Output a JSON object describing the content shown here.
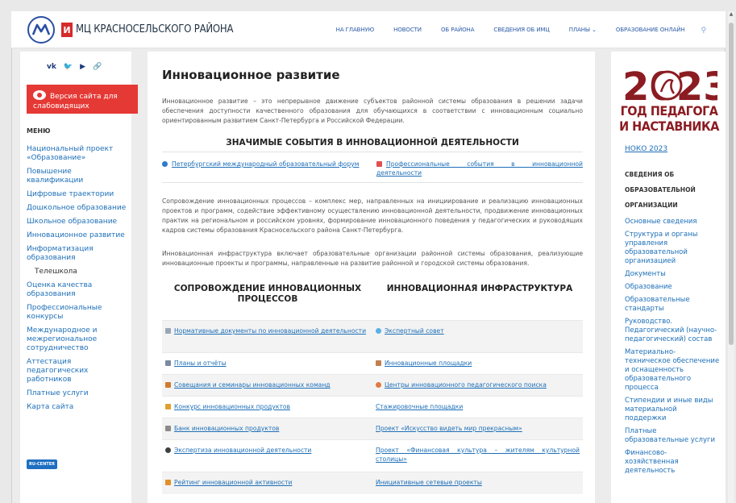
{
  "header": {
    "brand_mark": "И",
    "brand_text": "МЦ КРАСНОСЕЛЬСКОГО РАЙОНА",
    "nav": [
      "НА ГЛАВНУЮ",
      "НОВОСТИ",
      "ОБ РАЙОНА",
      "СВЕДЕНИЯ ОБ ИМЦ",
      "ПЛАНЫ ⌄",
      "ОБРАЗОВАНИЕ ОНЛАЙН"
    ],
    "search_icon": "search-icon"
  },
  "left": {
    "social": [
      "vk",
      "tw",
      "yt",
      "link"
    ],
    "low_vision_label": "Версия сайта для слабовидящих",
    "menu_title": "МЕНЮ",
    "menu": [
      "Национальный проект «Образование»",
      "Повышение квалификации",
      "Цифровые траектории",
      "Дошкольное образование",
      "Школьное образование",
      "Инновационное развитие",
      "Информатизация образования",
      "Телешкола",
      "Оценка качества образования",
      "Профессиональные конкурсы",
      "Международное и межрегиональное сотрудничество",
      "Аттестация педагогических работников",
      "Платные услуги",
      "Карта сайта"
    ],
    "rucenter": "RU-CENTER"
  },
  "main": {
    "title": "Инновационное развитие",
    "intro": "Инновационное развитие – это непрерывное движение субъектов районной системы образования в решении задачи обеспечения доступности качественного образования для обучающихся в соответствии с инновационным социально ориентированным развитием Санкт-Петербурга и Российской Федерации.",
    "events_title": "ЗНАЧИМЫЕ СОБЫТИЯ В ИННОВАЦИОННОЙ ДЕЯТЕЛЬНОСТИ",
    "event_left": "Петербургский международный образовательный форум",
    "event_right": "Профессиональные события в инновационной деятельности",
    "para2": "Сопровождение инновационных процессов – комплекс мер, направленных на инициирование и реализацию инновационных проектов и программ, содействие эффективному осуществлению инновационной деятельности, продвижение инновационных практик на региональном и российском уровнях, формирование инновационного поведения у педагогических и руководящих кадров системы образования Красносельского района Санкт-Петербурга.",
    "para3": "Инновационная инфраструктура включает образовательные организации районной системы образования, реализующие инновационные проекты и программы, направленные на развитие районной и городской системы образования.",
    "col_left_title": "СОПРОВОЖДЕНИЕ ИННОВАЦИОННЫХ ПРОЦЕССОВ",
    "col_right_title": "ИННОВАЦИОННАЯ ИНФРАСТРУКТУРА",
    "rows": [
      {
        "left": "Нормативные документы по инновационной деятельности",
        "right": "Экспертный совет",
        "left_icon": "#9aa6b8",
        "right_icon": "#5ab0e8"
      },
      {
        "left": "Планы и отчёты",
        "right": "Инновационные площадки",
        "left_icon": "#7a8aa0",
        "right_icon": "#c08050"
      },
      {
        "left": "Совещания и семинары инновационных команд",
        "right": "Центры инновационного педагогического поиска",
        "left_icon": "#d07a30",
        "right_icon": "#e07a40"
      },
      {
        "left": "Конкурс инновационных продуктов",
        "right": "Стажировочные площадки",
        "left_icon": "#e0a030",
        "right_icon": ""
      },
      {
        "left": "Банк инновационных продуктов",
        "right": "Проект «Искусство видеть мир прекрасным»",
        "left_icon": "#8a8a8a",
        "right_icon": ""
      },
      {
        "left": "Экспертиза инновационной деятельности",
        "right": "Проект «Финансовая культура – жителям культурной столицы»",
        "left_icon": "#404040",
        "right_icon": ""
      },
      {
        "left": "Рейтинг инновационной активности",
        "right": "Инициативные сетевые проекты",
        "left_icon": "#e0902a",
        "right_icon": ""
      }
    ]
  },
  "right": {
    "year": "2023",
    "year_text": "ГОД ПЕДАГОГА И НАСТАВНИКА",
    "noko": "НОКО 2023",
    "org_title": "СВЕДЕНИЯ ОБ ОБРАЗОВАТЕЛЬНОЙ ОРГАНИЗАЦИИ",
    "menu": [
      "Основные сведения",
      "Структура и органы управления образовательной организацией",
      "Документы",
      "Образование",
      "Образовательные стандарты",
      "Руководство. Педагогический (научно-педагогический) состав",
      "Материально-техническое обеспечение и оснащенность образовательного процесса",
      "Стипендии и иные виды материальной поддержки",
      "Платные образовательные услуги",
      "Финансово-хозяйственная деятельность"
    ]
  },
  "colors": {
    "accent": "#1d6fb8",
    "brand_red": "#d52b2b",
    "low_vision_bg": "#e53935",
    "year_red": "#8b1c22"
  }
}
